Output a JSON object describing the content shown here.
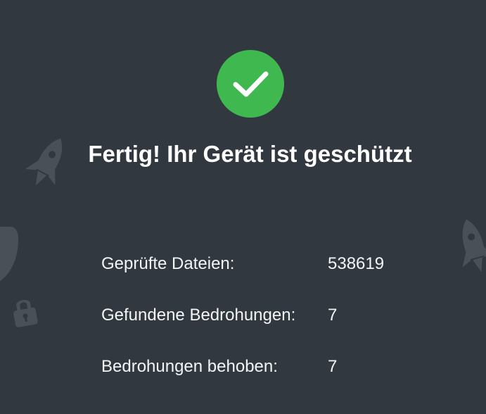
{
  "icons": {
    "status": "checkmark-icon",
    "decorations": [
      "rocket-icon",
      "rocket-icon",
      "shield-icon",
      "lock-icon"
    ]
  },
  "colors": {
    "background": "#323840",
    "success": "#3fb94f",
    "decoration": "#4a5058"
  },
  "result": {
    "title": "Fertig! Ihr Gerät ist geschützt"
  },
  "stats": [
    {
      "label": "Geprüfte Dateien:",
      "value": "538619"
    },
    {
      "label": "Gefundene Bedrohungen:",
      "value": "7"
    },
    {
      "label": "Bedrohungen behoben:",
      "value": "7"
    }
  ]
}
